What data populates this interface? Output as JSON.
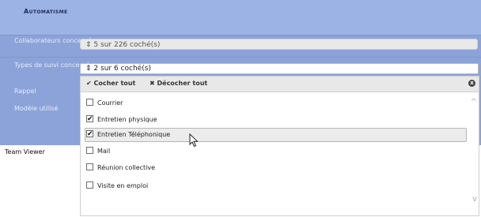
{
  "header": {
    "title": "Automatisme"
  },
  "form": {
    "collab_label": "Collaborateurs concernés",
    "collab_value": "5 sur 226 coché(s)",
    "suivi_label": "Types de suivi concernés",
    "suivi_value": "2 sur 6 coché(s)",
    "rappel_label": "Rappel",
    "modele_label": "Modèle utilisé",
    "team_label": "Team Viewer",
    "select_arrow": "⇕"
  },
  "dropdown": {
    "check_all_icon": "✔",
    "check_all": "Cocher tout",
    "uncheck_all_icon": "✖",
    "uncheck_all": "Décocher tout",
    "close_icon": "x",
    "scroll_up": "^",
    "scroll_down": "v",
    "items": [
      {
        "label": "Courrier",
        "check": ""
      },
      {
        "label": "Entretien physique",
        "check": "✔"
      },
      {
        "label": "Entretien Téléphonique",
        "check": "✔"
      },
      {
        "label": "Mail",
        "check": ""
      },
      {
        "label": "Réunion collective",
        "check": ""
      },
      {
        "label": "Visite en emploi",
        "check": ""
      }
    ]
  }
}
